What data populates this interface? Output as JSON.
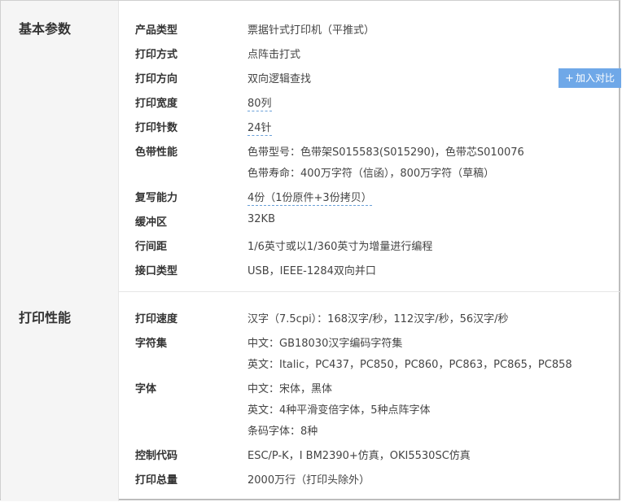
{
  "sections": [
    {
      "title": "基本参数",
      "rows": [
        {
          "label": "产品类型",
          "values": [
            "票据针式打印机（平推式）"
          ]
        },
        {
          "label": "打印方式",
          "values": [
            "点阵击打式"
          ]
        },
        {
          "label": "打印方向",
          "values": [
            "双向逻辑查找"
          ]
        },
        {
          "label": "打印宽度",
          "values": [
            "80列"
          ]
        },
        {
          "label": "打印针数",
          "values": [
            "24针"
          ]
        },
        {
          "label": "色带性能",
          "values": [
            "色带型号：色带架S015583(S015290)，色带芯S010076",
            "色带寿命：400万字符（信函），800万字符（草稿）"
          ]
        },
        {
          "label": "复写能力",
          "values": [
            "4份（1份原件+3份拷贝）"
          ]
        },
        {
          "label": "缓冲区",
          "values": [
            "32KB"
          ]
        },
        {
          "label": "行间距",
          "values": [
            "1/6英寸或以1/360英寸为增量进行编程"
          ]
        },
        {
          "label": "接口类型",
          "values": [
            "USB，IEEE-1284双向并口"
          ]
        }
      ]
    },
    {
      "title": "打印性能",
      "rows": [
        {
          "label": "打印速度",
          "values": [
            "汉字（7.5cpi）：168汉字/秒，112汉字/秒，56汉字/秒"
          ]
        },
        {
          "label": "字符集",
          "values": [
            "中文：GB18030汉字编码字符集",
            "英文：Italic，PC437，PC850，PC860，PC863，PC865，PC858"
          ]
        },
        {
          "label": "字体",
          "values": [
            "中文：宋体，黑体",
            "英文：4种平滑变倍字体，5种点阵字体",
            "条码字体：8种"
          ]
        },
        {
          "label": "控制代码",
          "values": [
            "ESC/P-K，I BM2390+仿真，OKI5530SC仿真"
          ]
        },
        {
          "label": "打印总量",
          "values": [
            "2000万行（打印头除外）"
          ]
        }
      ]
    }
  ],
  "compare_button": {
    "label": "加入对比",
    "icon": "plus-icon"
  },
  "colors": {
    "accent": "#6fa8e8",
    "category_bg": "#f5f5f5",
    "link_underline": "#6aa0d8"
  }
}
